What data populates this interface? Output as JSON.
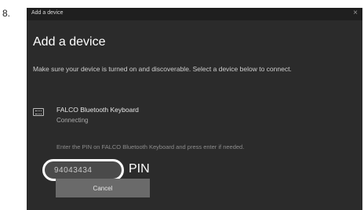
{
  "step_number": "8.",
  "window": {
    "title": "Add a device",
    "close_glyph": "×"
  },
  "heading": "Add a device",
  "description": "Make sure your device is turned on and discoverable. Select a device below to connect.",
  "device": {
    "icon": "keyboard-icon",
    "name": "FALCO Bluetooth Keyboard",
    "status": "Connecting",
    "instructions": "Enter the PIN on FALCO Bluetooth Keyboard and press enter if needed.",
    "pin": "94043434"
  },
  "annotation_label": "PIN",
  "cancel_label": "Cancel"
}
